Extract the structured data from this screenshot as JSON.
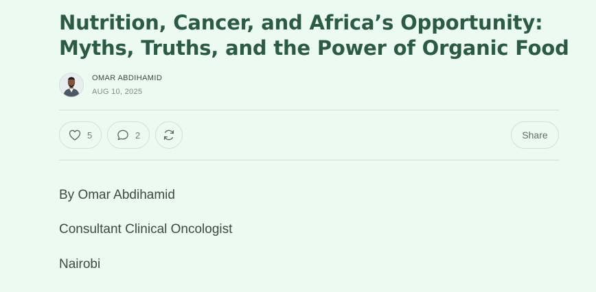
{
  "article": {
    "title_line1": "Nutrition, Cancer, and Africa’s Opportunity:",
    "title_line2": "Myths, Truths, and the Power of Organic Food",
    "author": "OMAR ABDIHAMID",
    "date": "AUG 10, 2025"
  },
  "actions": {
    "like_count": "5",
    "comment_count": "2",
    "share_label": "Share"
  },
  "icons": {
    "like": "heart-icon",
    "comment": "speech-bubble-icon",
    "restack": "refresh-arrows-icon"
  },
  "body": {
    "byline": "By Omar Abdihamid",
    "role": "Consultant Clinical Oncologist",
    "location": "Nairobi"
  },
  "colors": {
    "background": "#ecfbf1",
    "title": "#2d5a44",
    "text": "#3b4a44",
    "border": "#d3ddd8"
  }
}
